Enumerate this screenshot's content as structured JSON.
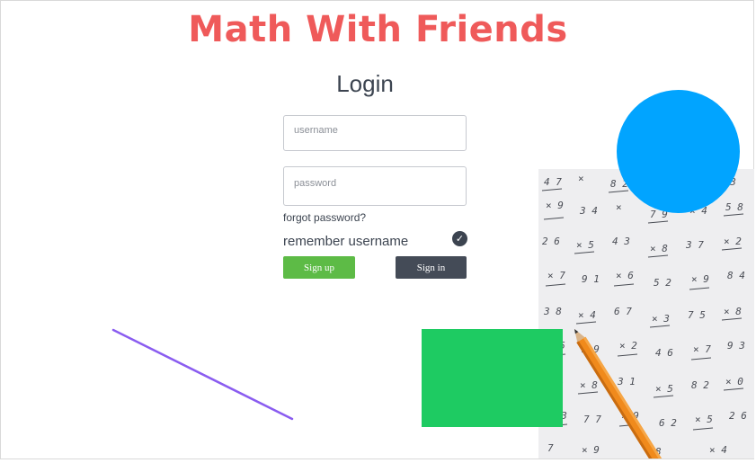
{
  "app": {
    "title": "Math With Friends"
  },
  "login": {
    "heading": "Login",
    "username_placeholder": "username",
    "password_placeholder": "password",
    "forgot_password": "forgot password?",
    "remember_username": "remember username",
    "remember_checked": true,
    "signup_label": "Sign up",
    "signin_label": "Sign in"
  },
  "colors": {
    "title": "#ef5a5a",
    "signup": "#5dbb46",
    "signin": "#444b57",
    "blue_circle": "#01a4ff",
    "green_square": "#1ecb62",
    "line": "#8a5cf0"
  },
  "icons": {
    "remember": "check-circle-icon"
  }
}
